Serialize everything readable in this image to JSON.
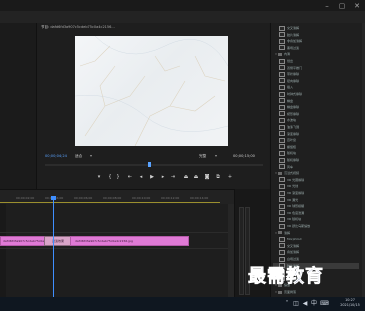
{
  "menu": {
    "items": [
      "学习",
      "组件",
      "编辑",
      "颜色",
      "效果",
      "音频",
      "图形",
      "库"
    ],
    "active_index": 4
  },
  "program_monitor": {
    "tab_label": "节目:",
    "sequence_name": "dafd6fd3a907c5cdeb75c0a4c2156...",
    "current_timecode": "00;00;04;24",
    "fit_label": "适合",
    "quality_label": "完整",
    "duration_timecode": "00;00;15;00"
  },
  "timeline": {
    "ruler_ticks": [
      "00;00;02;00",
      "00;00;04;00",
      "00;00;06;00",
      "00;00;08;00",
      "00;00;10;00",
      "00;00;12;00",
      "00;00;14;00"
    ],
    "clips": [
      {
        "label": "dafd6fd3a907c5cdeb75c0a4c2156.jpg"
      },
      {
        "label": "过渡效果"
      },
      {
        "label": "dafd6fd3a907c5cdeb75c0a4c2156.jpg"
      }
    ]
  },
  "effects_panel": {
    "items": [
      {
        "label": "交叉溶解",
        "level": 2,
        "fx": true
      },
      {
        "label": "胶片溶解",
        "level": 2,
        "fx": true
      },
      {
        "label": "非叠加溶解",
        "level": 2,
        "fx": true
      },
      {
        "label": "黑场过渡",
        "level": 2,
        "fx": true
      },
      {
        "label": "内滑",
        "level": 1,
        "fx": false
      },
      {
        "label": "划出",
        "level": 2,
        "fx": true
      },
      {
        "label": "双侧平推门",
        "level": 2,
        "fx": true
      },
      {
        "label": "带状擦除",
        "level": 2,
        "fx": true
      },
      {
        "label": "径向擦除",
        "level": 2,
        "fx": true
      },
      {
        "label": "插入",
        "level": 2,
        "fx": true
      },
      {
        "label": "时钟式擦除",
        "level": 2,
        "fx": true
      },
      {
        "label": "棋盘",
        "level": 2,
        "fx": true
      },
      {
        "label": "棋盘擦除",
        "level": 2,
        "fx": true
      },
      {
        "label": "楔形擦除",
        "level": 2,
        "fx": true
      },
      {
        "label": "水波块",
        "level": 2,
        "fx": true
      },
      {
        "label": "油漆飞溅",
        "level": 2,
        "fx": true
      },
      {
        "label": "渐变擦除",
        "level": 2,
        "fx": true
      },
      {
        "label": "百叶窗",
        "level": 2,
        "fx": true
      },
      {
        "label": "螺旋框",
        "level": 2,
        "fx": true
      },
      {
        "label": "随机块",
        "level": 2,
        "fx": true
      },
      {
        "label": "随机擦除",
        "level": 2,
        "fx": true
      },
      {
        "label": "风车",
        "level": 2,
        "fx": true
      },
      {
        "label": "沉浸式视频",
        "level": 1,
        "fx": false
      },
      {
        "label": "VR 光圈擦除",
        "level": 2,
        "fx": true
      },
      {
        "label": "VR 光线",
        "level": 2,
        "fx": true
      },
      {
        "label": "VR 渐变擦除",
        "level": 2,
        "fx": true
      },
      {
        "label": "VR 漏光",
        "level": 2,
        "fx": true
      },
      {
        "label": "VR 球形模糊",
        "level": 2,
        "fx": true
      },
      {
        "label": "VR 色度泄漏",
        "level": 2,
        "fx": true
      },
      {
        "label": "VR 随机块",
        "level": 2,
        "fx": true
      },
      {
        "label": "VR 默比乌斯缩放",
        "level": 2,
        "fx": true
      },
      {
        "label": "溶解",
        "level": 1,
        "fx": false
      },
      {
        "label": "MorphCut",
        "level": 2,
        "fx": true
      },
      {
        "label": "交叉溶解",
        "level": 2,
        "fx": true
      },
      {
        "label": "叠加溶解",
        "level": 2,
        "fx": true
      },
      {
        "label": "白场过渡",
        "level": 2,
        "fx": true
      },
      {
        "label": "胶片溶解",
        "level": 2,
        "fx": true,
        "highlighted": true
      },
      {
        "label": "非叠加溶解",
        "level": 2,
        "fx": true
      },
      {
        "label": "黑场过渡",
        "level": 2,
        "fx": true
      },
      {
        "label": "缩放",
        "level": 1,
        "fx": false
      },
      {
        "label": "页面剥落",
        "level": 1,
        "fx": false
      }
    ]
  },
  "taskbar": {
    "time": "10:27",
    "date": "2021/10/15"
  },
  "watermark": "最需教育",
  "colors": {
    "accent": "#5aa3ff",
    "clip": "#e07ad6",
    "playhead": "#3f8fff",
    "track_bar": "#9b8f2e"
  }
}
